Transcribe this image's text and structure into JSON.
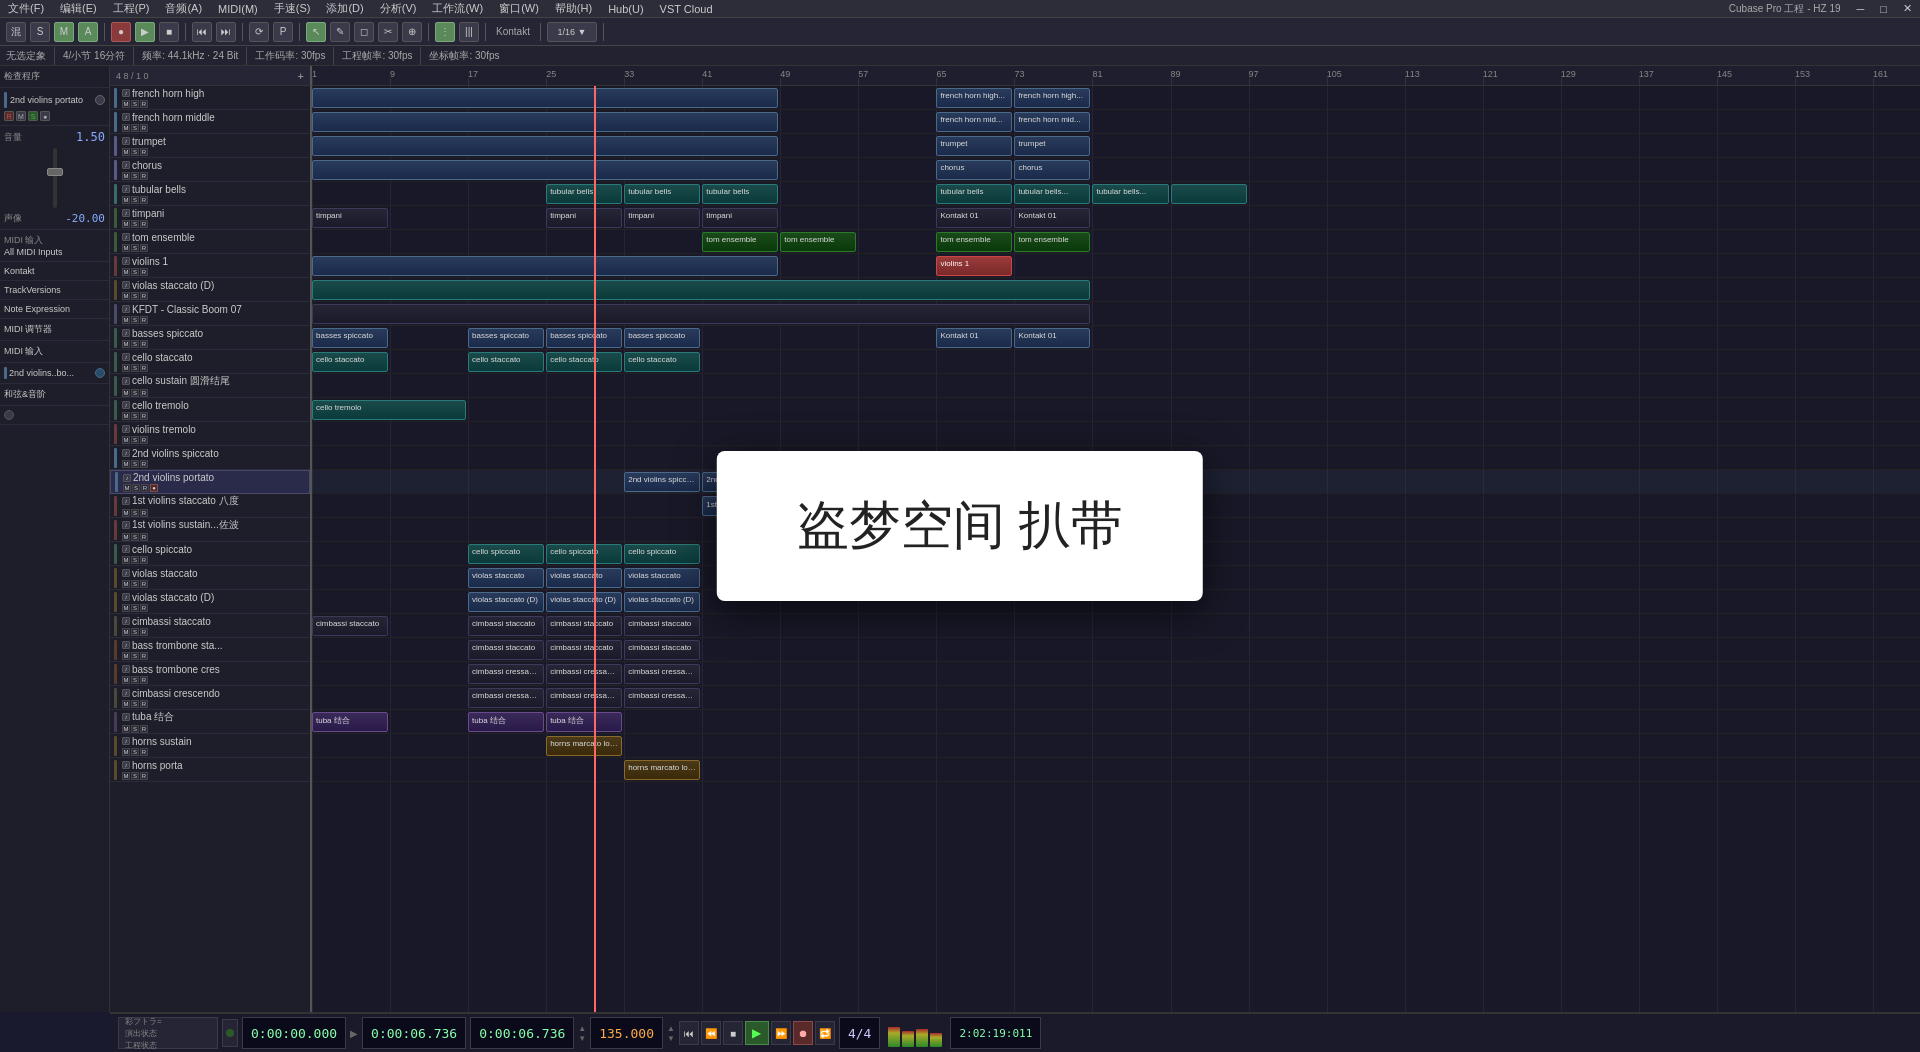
{
  "app": {
    "title": "Cubase Pro 工程 - HZ 19",
    "window_title": "Cubase Pro 工程 - HZ 19"
  },
  "menu": {
    "items": [
      "文件(F)",
      "编辑(E)",
      "工程(P)",
      "音频(A)",
      "MIDI(M)",
      "手速(S)",
      "添加(D)",
      "分析(V)",
      "工作流(W)",
      "窗口(W)",
      "帮助(H)",
      "Hub(U)",
      "VST Cloud"
    ]
  },
  "toolbar": {
    "items": [
      "混",
      "S",
      "M",
      "A",
      "■",
      "▶",
      "■",
      "⏺"
    ]
  },
  "sub_toolbar": {
    "info": "无选定象",
    "items": [
      "4/小节 16分符",
      "频率: 44.1kHz · 24 Bit",
      "工作码率: 30fps",
      "工程帧率: 30fps",
      "坐标帧率: 30fps"
    ]
  },
  "inspector": {
    "track_name": "2nd violins portato",
    "volume_label": "1.50",
    "pan_label": "-20.00",
    "midi_input": "All MIDI Inputs",
    "kontakt": "Kontakt",
    "track_versions": "TrackVersions",
    "note_expression": "Note Expression",
    "midi_modifier": "MIDI 调节器",
    "midi_input2": "MIDI 输入",
    "track_name2": "2nd violins..bo...",
    "chord": "和弦&音阶"
  },
  "track_list_header": {
    "label": "4 8 / 1 0",
    "add_button": "+"
  },
  "tracks": [
    {
      "name": "french horn high",
      "color": "#4a6a8a",
      "type": "midi"
    },
    {
      "name": "french horn middle",
      "color": "#4a6a8a",
      "type": "midi"
    },
    {
      "name": "trumpet",
      "color": "#5a5a8a",
      "type": "midi"
    },
    {
      "name": "chorus",
      "color": "#5a5a8a",
      "type": "midi"
    },
    {
      "name": "tubular bells",
      "color": "#3a6a6a",
      "type": "midi"
    },
    {
      "name": "timpani",
      "color": "#3a5a3a",
      "type": "midi"
    },
    {
      "name": "tom ensemble",
      "color": "#3a5a3a",
      "type": "midi"
    },
    {
      "name": "violins 1",
      "color": "#6a3a3a",
      "type": "midi"
    },
    {
      "name": "violas staccato (D)",
      "color": "#5a4a2a",
      "type": "midi"
    },
    {
      "name": "KFDT - Classic Boom 07",
      "color": "#4a4a6a",
      "type": "midi"
    },
    {
      "name": "basses spiccato",
      "color": "#3a5a4a",
      "type": "midi"
    },
    {
      "name": "cello staccato",
      "color": "#3a5a4a",
      "type": "midi"
    },
    {
      "name": "cello sustain 圆滑结尾",
      "color": "#3a5a4a",
      "type": "midi"
    },
    {
      "name": "cello tremolo",
      "color": "#3a5a4a",
      "type": "midi"
    },
    {
      "name": "violins tremolo",
      "color": "#6a3a3a",
      "type": "midi"
    },
    {
      "name": "2nd violins spiccato",
      "color": "#4a6a8a",
      "type": "midi"
    },
    {
      "name": "2nd violins portato",
      "color": "#4a6a8a",
      "type": "midi",
      "selected": true
    },
    {
      "name": "1st violins staccato 八度",
      "color": "#6a3a3a",
      "type": "midi"
    },
    {
      "name": "1st violins sustain...佐波",
      "color": "#6a3a3a",
      "type": "midi"
    },
    {
      "name": "cello spiccato",
      "color": "#3a5a4a",
      "type": "midi"
    },
    {
      "name": "violas staccato",
      "color": "#5a4a2a",
      "type": "midi"
    },
    {
      "name": "violas staccato (D)",
      "color": "#5a4a2a",
      "type": "midi"
    },
    {
      "name": "cimbassi staccato",
      "color": "#4a4a3a",
      "type": "midi"
    },
    {
      "name": "bass trombone sta...",
      "color": "#5a3a2a",
      "type": "midi"
    },
    {
      "name": "bass trombone cres",
      "color": "#5a3a2a",
      "type": "midi"
    },
    {
      "name": "cimbassi crescendo",
      "color": "#4a4a3a",
      "type": "midi"
    },
    {
      "name": "tuba 结合",
      "color": "#4a3a5a",
      "type": "midi"
    },
    {
      "name": "horns sustain",
      "color": "#5a4a2a",
      "type": "midi"
    },
    {
      "name": "horns porta",
      "color": "#5a4a2a",
      "type": "midi"
    }
  ],
  "timeline": {
    "markers": [
      1,
      9,
      17,
      25,
      33,
      41,
      49,
      57,
      65,
      73,
      81,
      89,
      97,
      105,
      113,
      121,
      129,
      137,
      145,
      153,
      161
    ]
  },
  "overlay": {
    "text": "盗梦空间 扒带"
  },
  "transport": {
    "time_display1": "0:00:00.000",
    "time_display2": "0:00:06.736",
    "time_display3": "0:00:06.736",
    "bar_display": "2:02:19:011",
    "bpm": "135.000",
    "time_sig": "4/4",
    "play_btn": "▶",
    "stop_btn": "■",
    "rewind_btn": "⏮",
    "forward_btn": "⏭",
    "record_btn": "⏺",
    "loop_btn": "🔁",
    "track_info1": "彩フトラ=",
    "track_info2": "演出状态",
    "track_info3": "工程状态"
  }
}
